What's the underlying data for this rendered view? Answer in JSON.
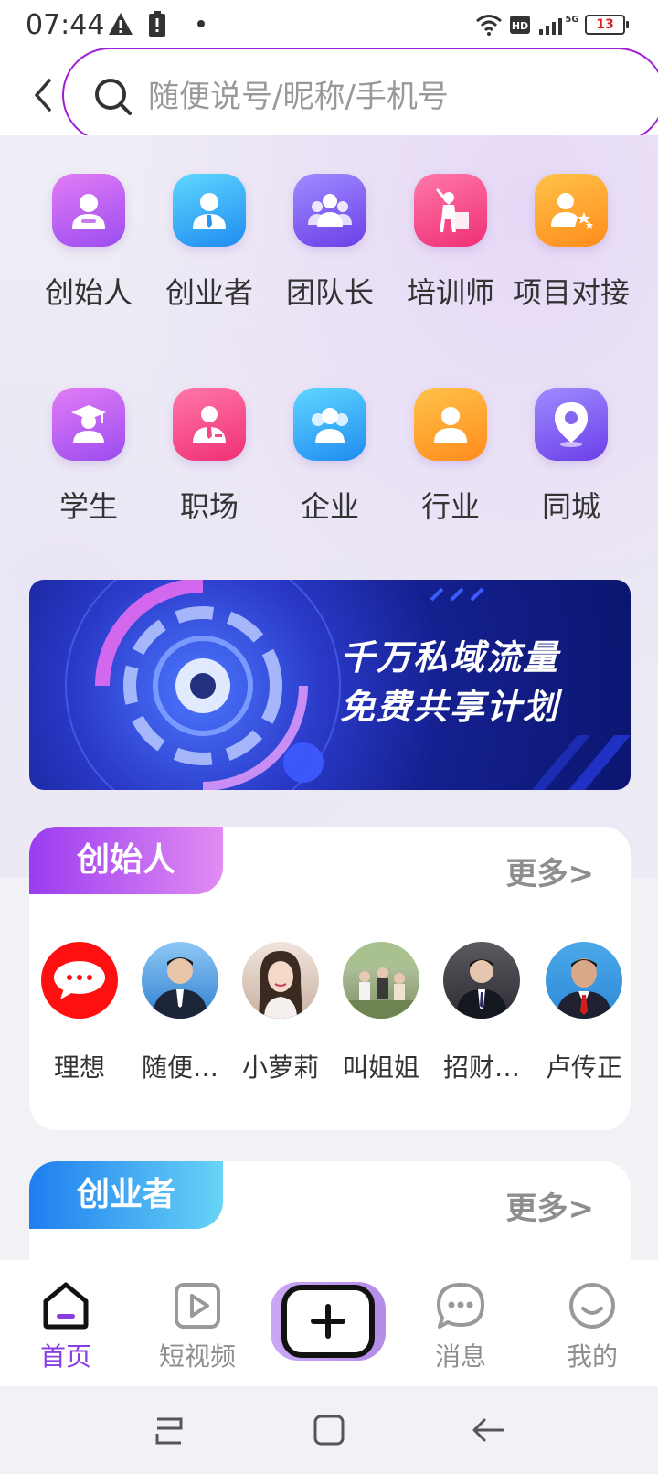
{
  "status_bar": {
    "time": "07:44",
    "battery_level": "13",
    "network": "5G",
    "icons": [
      "warning-icon",
      "battery-saver-icon",
      "dot-icon",
      "wifi-icon",
      "hd-icon",
      "signal-icon",
      "battery-icon"
    ]
  },
  "search": {
    "placeholder": "随便说号/昵称/手机号",
    "value": ""
  },
  "categories": [
    {
      "label": "创始人",
      "icon": "founder-icon",
      "color": "purple"
    },
    {
      "label": "创业者",
      "icon": "entrepreneur-icon",
      "color": "blue"
    },
    {
      "label": "团队长",
      "icon": "team-leader-icon",
      "color": "violet"
    },
    {
      "label": "培训师",
      "icon": "trainer-icon",
      "color": "pink"
    },
    {
      "label": "项目对接",
      "icon": "project-match-icon",
      "color": "orange"
    },
    {
      "label": "学生",
      "icon": "student-icon",
      "color": "purple"
    },
    {
      "label": "职场",
      "icon": "workplace-icon",
      "color": "pink"
    },
    {
      "label": "企业",
      "icon": "enterprise-icon",
      "color": "blue"
    },
    {
      "label": "行业",
      "icon": "industry-icon",
      "color": "orange"
    },
    {
      "label": "同城",
      "icon": "location-icon",
      "color": "violet"
    }
  ],
  "banner": {
    "line1": "千万私域流量",
    "line2": "免费共享计划"
  },
  "sections": [
    {
      "title": "创始人",
      "more": "更多>",
      "members": [
        {
          "name": "理想",
          "avatar": "chat-bubble-logo"
        },
        {
          "name": "随便…",
          "avatar": "man-in-suit-photo"
        },
        {
          "name": "小萝莉",
          "avatar": "woman-portrait-photo"
        },
        {
          "name": "叫姐姐",
          "avatar": "group-outdoor-photo"
        },
        {
          "name": "招财…",
          "avatar": "man-in-car-photo"
        },
        {
          "name": "卢传正",
          "avatar": "man-red-tie-photo"
        }
      ]
    },
    {
      "title": "创业者",
      "more": "更多>",
      "members": []
    }
  ],
  "bottom_nav": [
    {
      "label": "首页",
      "icon": "home-icon",
      "active": true
    },
    {
      "label": "短视频",
      "icon": "video-icon",
      "active": false
    },
    {
      "label": "",
      "icon": "add-icon",
      "active": false
    },
    {
      "label": "消息",
      "icon": "message-icon",
      "active": false
    },
    {
      "label": "我的",
      "icon": "profile-icon",
      "active": false
    }
  ],
  "colors": {
    "accent": "#8a3de0",
    "search_border": "#a01fd6",
    "battery_text": "#d81e1e"
  }
}
